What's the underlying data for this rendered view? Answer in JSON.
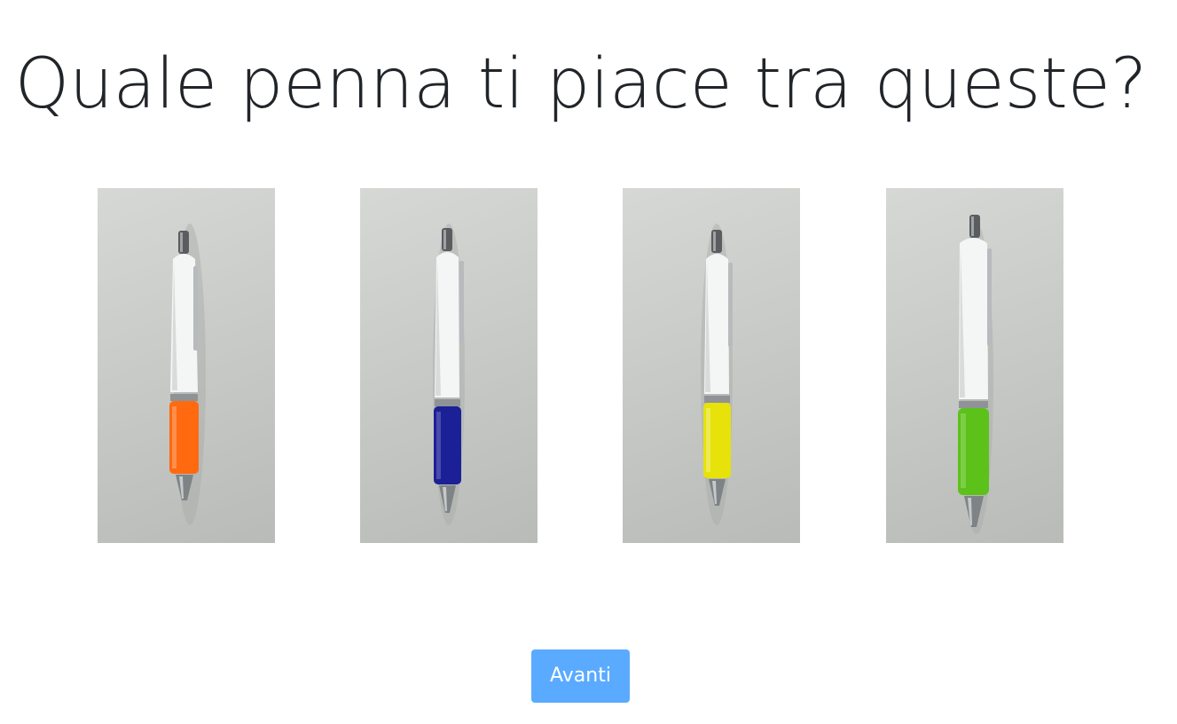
{
  "question": {
    "title": "Quale penna ti piace tra queste?"
  },
  "options": [
    {
      "name": "pen-orange",
      "grip_color": "#ff6a10"
    },
    {
      "name": "pen-blue",
      "grip_color": "#1c2096"
    },
    {
      "name": "pen-yellow",
      "grip_color": "#e6e20a"
    },
    {
      "name": "pen-green",
      "grip_color": "#5cc21a"
    }
  ],
  "actions": {
    "next_label": "Avanti",
    "next_color": "#5aabff"
  }
}
